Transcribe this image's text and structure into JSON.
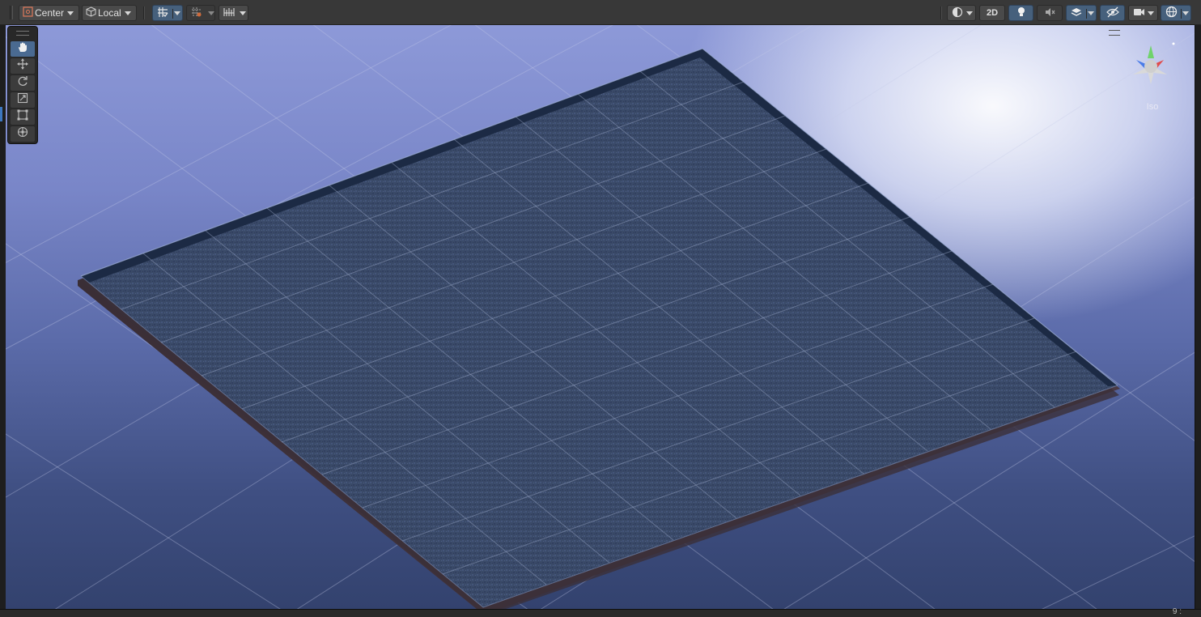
{
  "toolbar": {
    "pivot_mode_label": "Center",
    "pivot_rotation_label": "Local",
    "view_2d_label": "2D"
  },
  "gizmo": {
    "projection_label": "Iso"
  },
  "tools": [
    "hand-tool",
    "move-tool",
    "rotate-tool",
    "scale-tool",
    "rect-tool",
    "transform-tool"
  ],
  "colors": {
    "toolbar_bg": "#383838",
    "active_blue": "#46607c",
    "plane_surface": "#3a4a68",
    "plane_edge": "#1c2a44",
    "sky_top": "#8d99d8",
    "gizmo_y": "#6fd36b",
    "gizmo_x": "#e04c4c",
    "gizmo_z": "#4a7ce8"
  },
  "bottom_bar": {
    "status_text": "9 :"
  }
}
